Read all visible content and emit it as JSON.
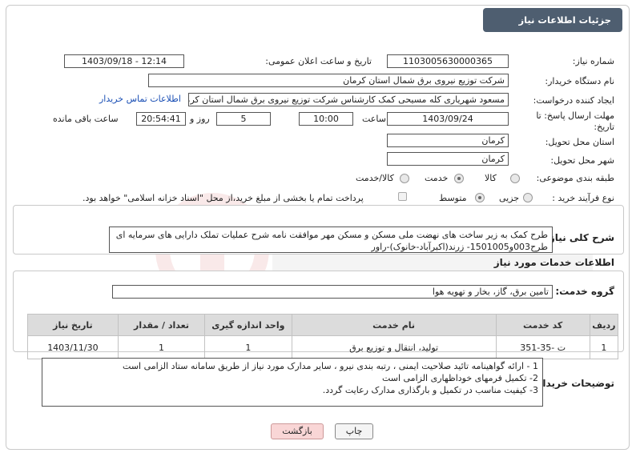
{
  "header": {
    "title": "جزئیات اطلاعات نیاز"
  },
  "need_number": {
    "label": "شماره نیاز:",
    "value": "1103005630000365"
  },
  "announce": {
    "label": "تاریخ و ساعت اعلان عمومی:",
    "value": "1403/09/18 - 12:14"
  },
  "buyer": {
    "label": "نام دستگاه خریدار:",
    "value": "شرکت توزیع نیروی برق شمال استان کرمان"
  },
  "creator": {
    "label": "ایجاد کننده درخواست:",
    "value": "مسعود شهریاری کله مسیحی کمک کارشناس شرکت توزیع نیروی برق شمال استان کرمان",
    "contact_link": "اطلاعات تماس خریدار"
  },
  "deadline": {
    "label": "مهلت ارسال پاسخ: تا تاریخ:",
    "date": "1403/09/24",
    "time_label": "ساعت",
    "time": "10:00",
    "days": "5",
    "days_label": "روز و",
    "remaining": "20:54:41",
    "remaining_label": "ساعت باقی مانده"
  },
  "province": {
    "label": "استان محل تحویل:",
    "value": "کرمان"
  },
  "city": {
    "label": "شهر محل تحویل:",
    "value": "کرمان"
  },
  "category": {
    "label": "طبقه بندی موضوعی:",
    "options": [
      "کالا",
      "خدمت",
      "کالا/خدمت"
    ],
    "selected": "خدمت"
  },
  "process": {
    "label": "نوع فرآیند خرید :",
    "options": [
      "جزیی",
      "متوسط"
    ],
    "selected": "متوسط",
    "payment_note": "پرداخت تمام یا بخشی از مبلغ خرید،از محل \"اسناد خزانه اسلامی\" خواهد بود."
  },
  "summary": {
    "label": "شرح کلی نیاز:",
    "text": "طرح کمک به زیر ساخت های نهضت ملی مسکن و مسکن مهر موافقت نامه شرح عملیات تملک دارایی های سرمایه ای طرح003و1501005- زرند(اکبرآباد-خانوک)-راور"
  },
  "services": {
    "section_title": "اطلاعات خدمات مورد نیاز",
    "group_label": "گروه خدمت:",
    "group_value": "تامین برق، گاز، بخار و تهویه هوا",
    "columns": [
      "ردیف",
      "کد خدمت",
      "نام خدمت",
      "واحد اندازه گیری",
      "تعداد / مقدار",
      "تاریخ نیاز"
    ],
    "rows": [
      {
        "row": "1",
        "code": "ت -35-351",
        "name": "تولید، انتقال و توزیع برق",
        "unit": "1",
        "qty": "1",
        "date": "1403/11/30"
      }
    ]
  },
  "buyer_notes": {
    "label": "توضیحات خریدار:",
    "lines": [
      "1 - ارائه گواهینامه تائید صلاحیت ایمنی ، رتبه بندی نیرو ، سایر مدارک مورد نیاز از طریق سامانه ستاد الزامی است",
      "2- تکمیل فرمهای خوداظهاری الزامی است",
      "3- کیفیت مناسب در تکمیل و بارگذاری مدارک رعایت گردد."
    ]
  },
  "buttons": {
    "print": "چاپ",
    "back": "بازگشت"
  },
  "colors": {
    "header_bg": "#4e5e70",
    "link": "#1a4fb5",
    "table_header": "#dcdcdc",
    "back_button": "#f9d6d6"
  }
}
